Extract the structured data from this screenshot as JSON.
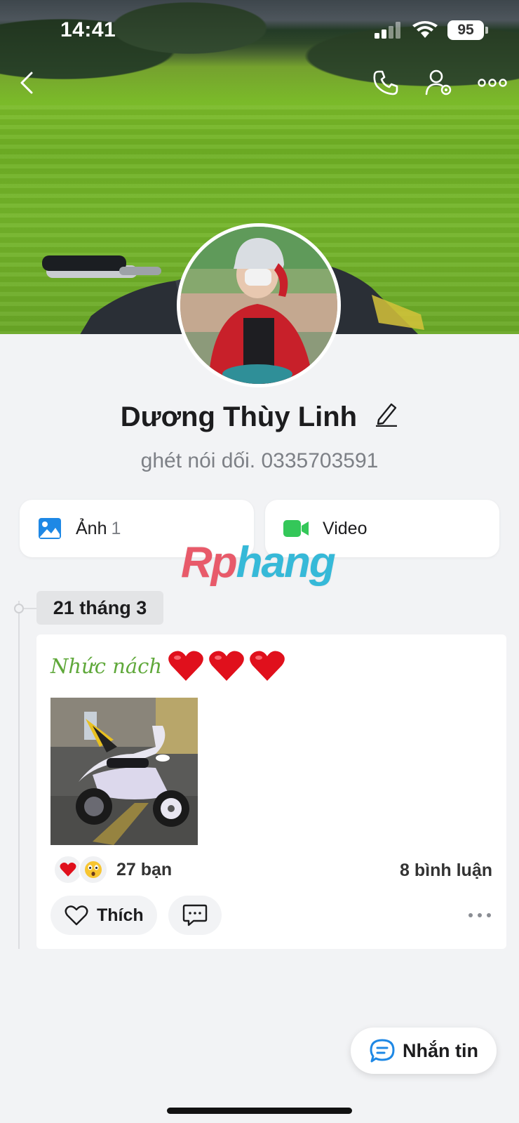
{
  "status_bar": {
    "time": "14:41",
    "battery": "95",
    "icons": [
      "signal-icon",
      "wifi-icon",
      "battery-icon"
    ]
  },
  "nav": {
    "icons": [
      "back-icon",
      "phone-icon",
      "user-settings-icon",
      "more-icon"
    ]
  },
  "profile": {
    "name": "Dương Thùy Linh",
    "bio": "ghét nói dối. 0335703591"
  },
  "media": {
    "photos_label": "Ảnh",
    "photos_count": "1",
    "video_label": "Video"
  },
  "watermark": {
    "part1": "Rp",
    "part2": "hang"
  },
  "timeline": {
    "date": "21 tháng 3"
  },
  "post": {
    "caption": "Nhức nách",
    "hearts": 3,
    "reaction_icons": [
      "heart-reaction-icon",
      "wow-reaction-icon"
    ],
    "reactions": "27 bạn",
    "comments": "8 bình luận",
    "like_label": "Thích"
  },
  "fab": {
    "label": "Nhắn tin"
  },
  "colors": {
    "accent_blue": "#1e88e5",
    "video_green": "#34c759",
    "caption_green": "#5fa83a",
    "heart_red": "#e0101c"
  }
}
